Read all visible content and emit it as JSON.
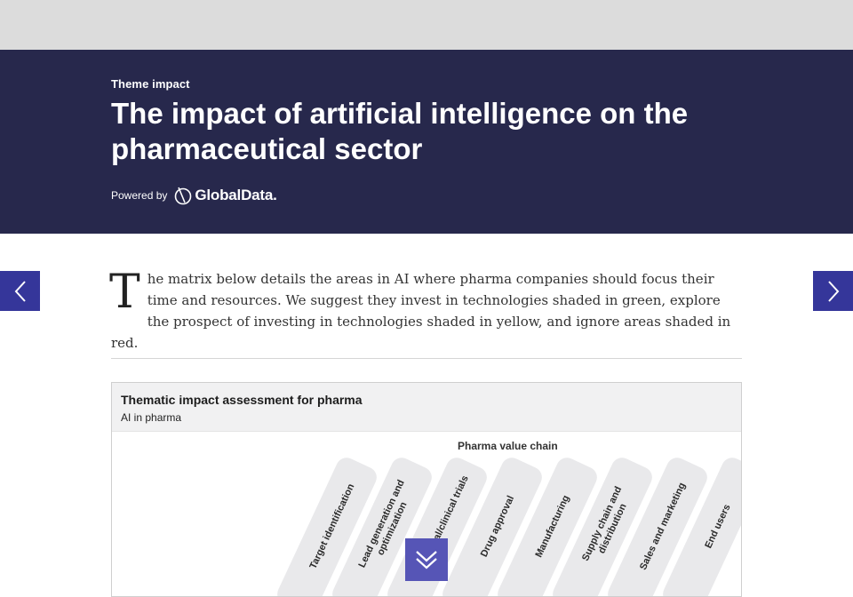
{
  "hero": {
    "eyebrow": "Theme impact",
    "title": "The impact of artificial intelligence on the pharmaceutical sector",
    "powered_label": "Powered by",
    "brand": "GlobalData."
  },
  "intro": {
    "dropcap": "T",
    "text": "he matrix below details the areas in AI where pharma companies should focus their time and resources. We suggest they invest in technologies shaded in green, explore the prospect of investing in technologies shaded in yellow, and ignore areas shaded in red."
  },
  "figure": {
    "title": "Thematic impact assessment for pharma",
    "subtitle": "AI in pharma",
    "chain_label": "Pharma value chain",
    "columns": [
      [
        "Target identification"
      ],
      [
        "Lead generation and",
        "optimization"
      ],
      [
        "Preclinical/clinical trials"
      ],
      [
        "Drug approval"
      ],
      [
        "Manufacturing"
      ],
      [
        "Supply chain and",
        "distribution"
      ],
      [
        "Sales and marketing"
      ],
      [
        "End users"
      ]
    ]
  },
  "icons": {
    "prev": "chevron-left-icon",
    "next": "chevron-right-icon",
    "scroll": "double-chevron-down-icon",
    "brand": "globaldata-logo-icon"
  },
  "colors": {
    "topbar": "#dcdcdc",
    "hero_bg": "#27284c",
    "nav_button": "#35369a",
    "scroll_button": "#5655b6",
    "pill": "#e9e9eb"
  }
}
